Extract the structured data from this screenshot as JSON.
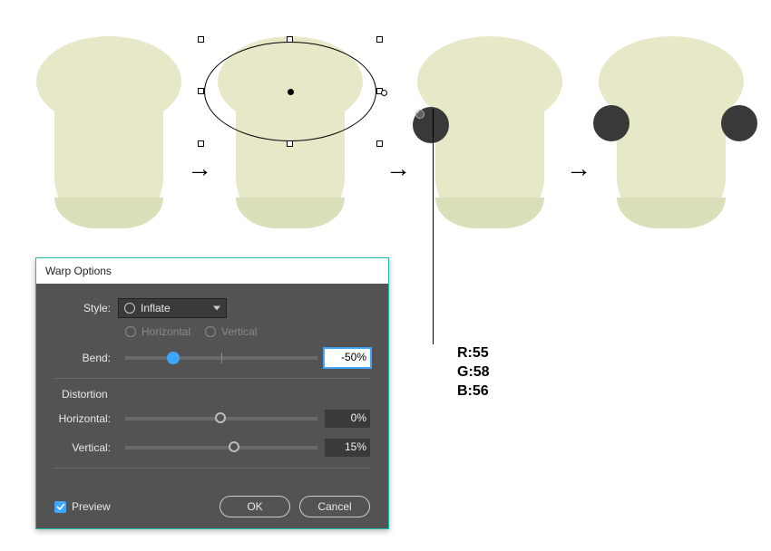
{
  "rgb": {
    "r": "R:55",
    "g": "G:58",
    "b": "B:56"
  },
  "dialog": {
    "title": "Warp Options",
    "style_label": "Style:",
    "style_value": "Inflate",
    "horiz_label": "Horizontal",
    "vert_label": "Vertical",
    "bend_label": "Bend:",
    "bend_value": "-50%",
    "distortion_label": "Distortion",
    "dist_h_label": "Horizontal:",
    "dist_h_value": "0%",
    "dist_v_label": "Vertical:",
    "dist_v_value": "15%",
    "preview_label": "Preview",
    "ok": "OK",
    "cancel": "Cancel"
  },
  "slider_pos": {
    "bend": 25,
    "dist_h": 50,
    "dist_v": 57
  }
}
